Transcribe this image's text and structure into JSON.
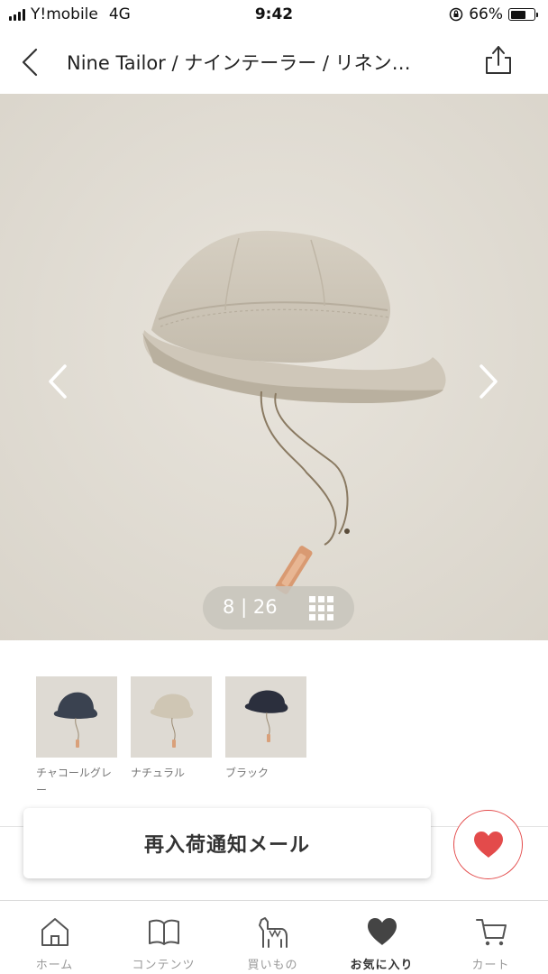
{
  "status_bar": {
    "carrier": "Y!mobile",
    "network": "4G",
    "time": "9:42",
    "battery_percent": "66%",
    "battery_level": 0.66
  },
  "header": {
    "title": "Nine Tailor / ナインテーラー / リネン…",
    "back_icon": "chevron-left-icon",
    "share_icon": "share-icon"
  },
  "gallery": {
    "current": "8",
    "separator": "|",
    "total": "26",
    "prev_icon": "chevron-left-icon",
    "next_icon": "chevron-right-icon",
    "grid_icon": "grid-icon"
  },
  "variants": [
    {
      "label": "チャコールグレー",
      "swatch": "#3a4250"
    },
    {
      "label": "ナチュラル",
      "swatch": "#cfc6b4"
    },
    {
      "label": "ブラック",
      "swatch": "#2b2f3d"
    }
  ],
  "actions": {
    "notify_label": "再入荷通知メール",
    "favorite_icon": "heart-icon",
    "accent": "#e34b4b"
  },
  "tabs": [
    {
      "label": "ホーム",
      "icon": "home-icon",
      "active": false
    },
    {
      "label": "コンテンツ",
      "icon": "book-icon",
      "active": false
    },
    {
      "label": "買いもの",
      "icon": "alpaca-icon",
      "active": false
    },
    {
      "label": "お気に入り",
      "icon": "heart-icon",
      "active": true
    },
    {
      "label": "カート",
      "icon": "cart-icon",
      "active": false
    }
  ]
}
